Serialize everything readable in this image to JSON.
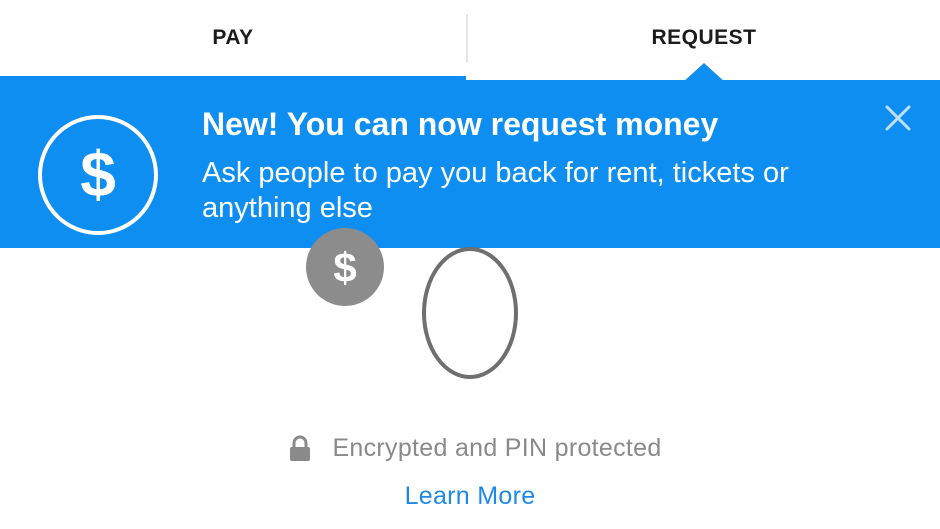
{
  "tabs": {
    "pay_label": "PAY",
    "request_label": "REQUEST",
    "active": "REQUEST"
  },
  "banner": {
    "title": "New! You can now request money",
    "body": "Ask people to pay you back for rent, tickets or anything else",
    "icon": "dollar-circle-icon",
    "close_icon": "close-icon",
    "background_color": "#0e8ef0",
    "text_color": "#ffffff"
  },
  "amount": {
    "currency_symbol": "$",
    "value": "0"
  },
  "footer": {
    "lock_icon": "lock-icon",
    "secure_text": "Encrypted and PIN protected",
    "learn_more_label": "Learn More",
    "link_color": "#1e8ae6"
  }
}
